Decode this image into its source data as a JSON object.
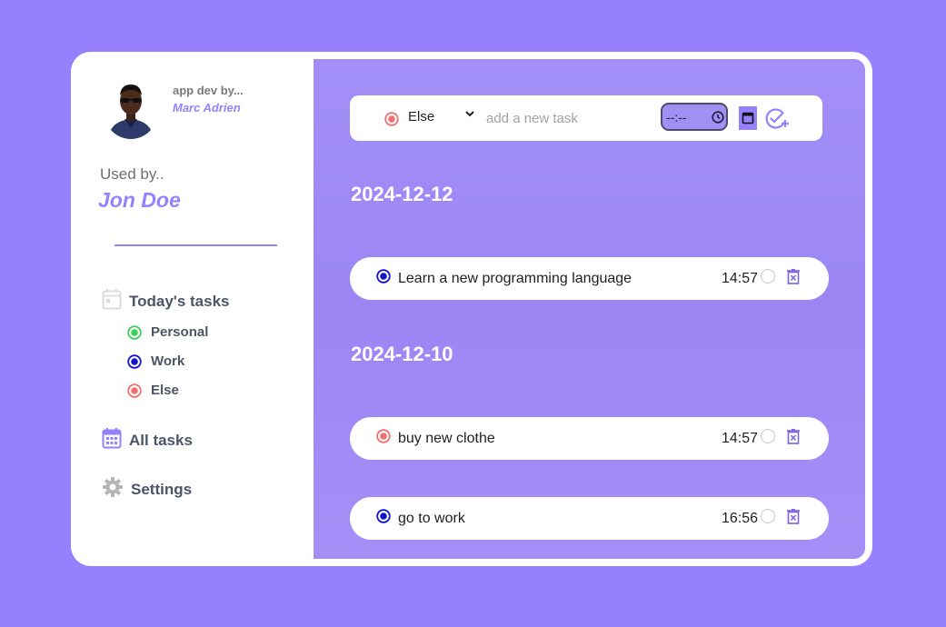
{
  "sidebar": {
    "dev_by": "app dev by...",
    "dev_name": "Marc Adrien",
    "used_by": "Used by..",
    "user_name": "Jon Doe",
    "today_tasks": "Today's tasks",
    "categories": [
      {
        "label": "Personal",
        "color": "#3ecf5a"
      },
      {
        "label": "Work",
        "color": "#1414c8"
      },
      {
        "label": "Else",
        "color": "#f07070"
      }
    ],
    "all_tasks": "All tasks",
    "settings": "Settings"
  },
  "input_bar": {
    "selected_category": "Else",
    "selected_color": "#f07070",
    "placeholder": "add a new task",
    "time_value": "--:--"
  },
  "groups": [
    {
      "date": "2024-12-12",
      "tasks": [
        {
          "text": "Learn a new programming language",
          "time": "14:57",
          "category": "Work"
        }
      ]
    },
    {
      "date": "2024-12-10",
      "tasks": [
        {
          "text": "buy new clothe",
          "time": "14:57",
          "category": "Else"
        },
        {
          "text": "go to work",
          "time": "16:56",
          "category": "Work"
        }
      ]
    }
  ],
  "colors": {
    "background": "#9780fe",
    "accent": "#9780fe",
    "personal": "#3ecf5a",
    "work": "#1414c8",
    "else": "#f07070"
  }
}
